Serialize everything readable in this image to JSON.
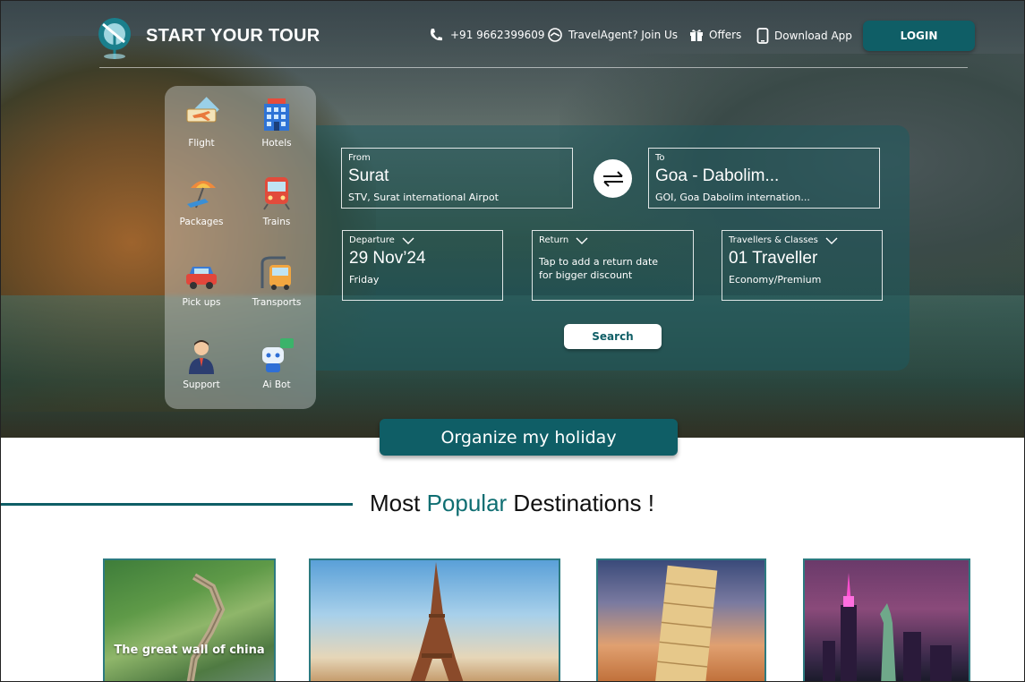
{
  "brand": {
    "name": "START YOUR TOUR"
  },
  "nav": {
    "phone": "+91 9662399609",
    "agent": "TravelAgent? Join Us",
    "offers": "Offers",
    "app": "Download App",
    "login": "LOGIN"
  },
  "services": [
    {
      "label": "Flight",
      "icon": "flight-icon"
    },
    {
      "label": "Hotels",
      "icon": "hotel-icon"
    },
    {
      "label": "Packages",
      "icon": "beach-package-icon"
    },
    {
      "label": "Trains",
      "icon": "train-icon"
    },
    {
      "label": "Pick ups",
      "icon": "car-icon"
    },
    {
      "label": "Transports",
      "icon": "bus-icon"
    },
    {
      "label": "Support",
      "icon": "support-agent-icon"
    },
    {
      "label": "Ai Bot",
      "icon": "robot-icon"
    }
  ],
  "search": {
    "from": {
      "label": "From",
      "city": "Surat",
      "airport": "STV, Surat international Airpot"
    },
    "to": {
      "label": "To",
      "city": "Goa - Dabolim...",
      "airport": "GOI, Goa Dabolim internation..."
    },
    "departure": {
      "label": "Departure",
      "date": "29 Nov’24",
      "day": "Friday"
    },
    "return": {
      "label": "Return",
      "hint_line1": "Tap to add a return date",
      "hint_line2": "for bigger discount"
    },
    "travellers": {
      "label": "Travellers & Classes",
      "count": "01 Traveller",
      "class": "Economy/Premium"
    },
    "button": "Search"
  },
  "organize": "Organize my holiday",
  "section": {
    "title_pre": "Most ",
    "title_accent": "Popular",
    "title_post": " Destinations !"
  },
  "destinations": [
    {
      "label": "The great wall of china"
    },
    {
      "label": ""
    },
    {
      "label": ""
    },
    {
      "label": ""
    }
  ],
  "colors": {
    "primary": "#0f5e66",
    "accent": "#0f6e72"
  }
}
